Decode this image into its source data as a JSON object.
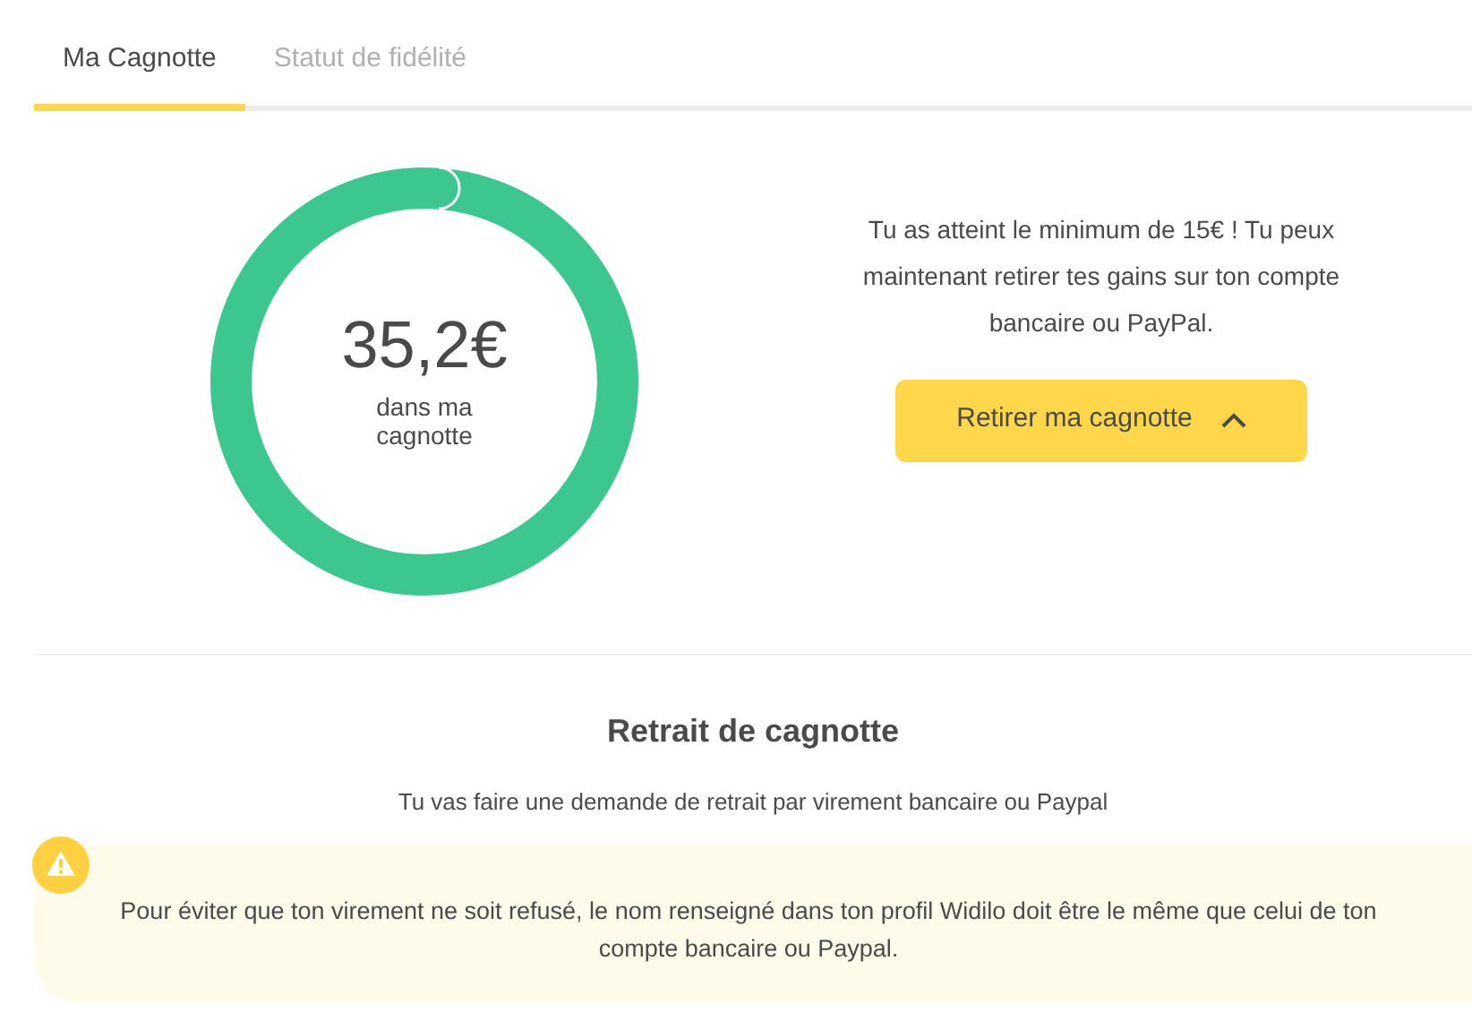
{
  "tabs": [
    {
      "label": "Ma Cagnotte",
      "selected": true
    },
    {
      "label": "Statut de fidélité",
      "selected": false
    }
  ],
  "balance": {
    "amount": "35,2€",
    "caption": "dans ma cagnotte"
  },
  "message": "Tu as atteint le minimum de 15€ ! Tu peux maintenant retirer tes gains sur ton compte bancaire ou PayPal.",
  "withdraw_button": {
    "label": "Retirer ma cagnotte",
    "expanded": true
  },
  "withdrawal": {
    "title": "Retrait de cagnotte",
    "subtitle": "Tu vas faire une demande de retrait par virement bancaire ou Paypal",
    "warning": "Pour éviter que ton virement ne soit refusé, le nom renseigné dans ton profil Widilo doit être le même que celui de ton compte bancaire ou Paypal."
  }
}
